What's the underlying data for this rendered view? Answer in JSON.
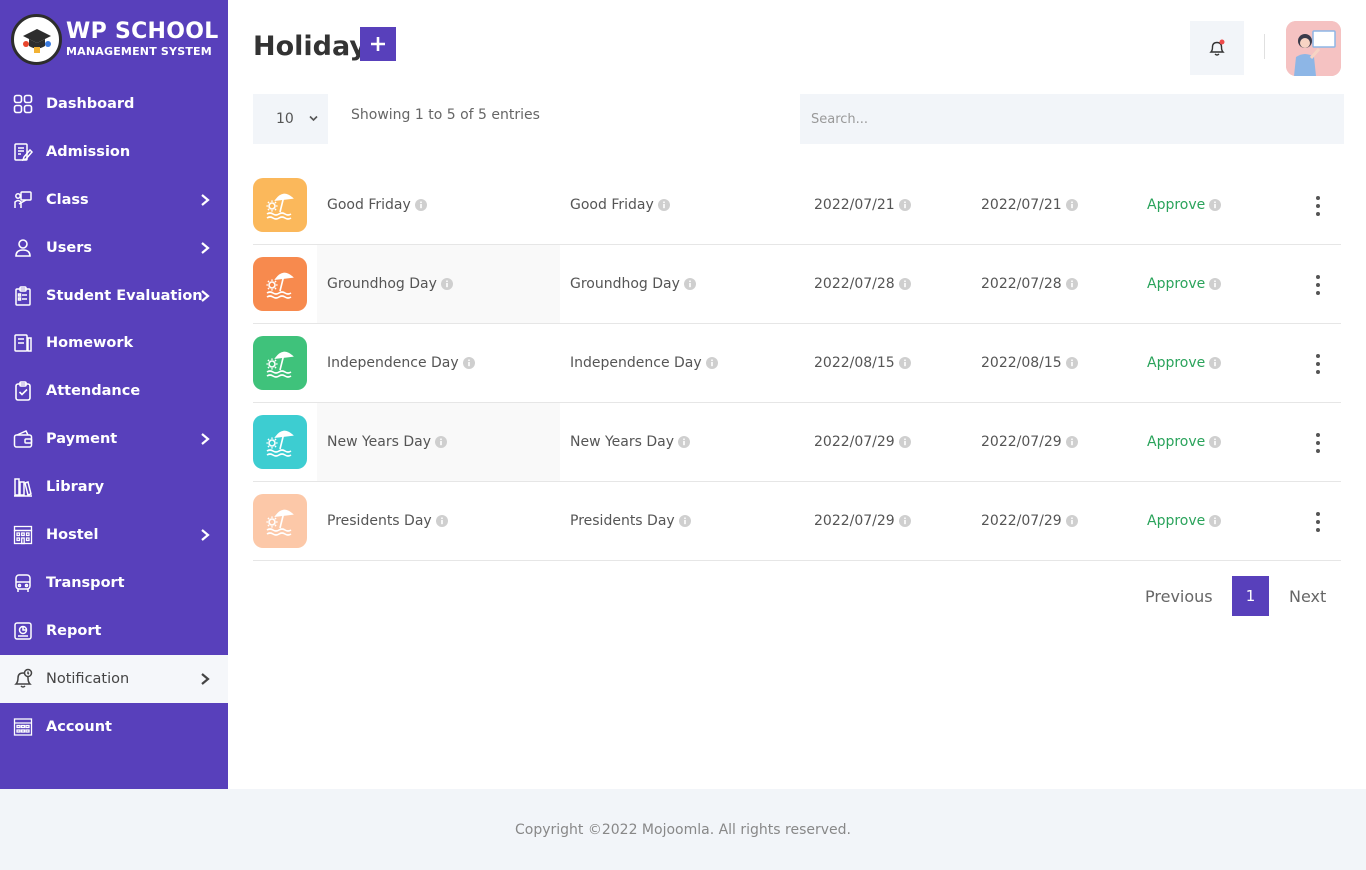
{
  "brand": {
    "title": "WP SCHOOL",
    "subtitle": "MANAGEMENT SYSTEM"
  },
  "sidebar": {
    "items": [
      {
        "label": "Dashboard",
        "icon": "grid-icon",
        "chevron": false
      },
      {
        "label": "Admission",
        "icon": "admission-icon",
        "chevron": false
      },
      {
        "label": "Class",
        "icon": "class-icon",
        "chevron": true
      },
      {
        "label": "Users",
        "icon": "user-icon",
        "chevron": true
      },
      {
        "label": "Student Evaluation",
        "icon": "clipboard-icon",
        "chevron": true
      },
      {
        "label": "Homework",
        "icon": "homework-icon",
        "chevron": false
      },
      {
        "label": "Attendance",
        "icon": "attendance-icon",
        "chevron": false
      },
      {
        "label": "Payment",
        "icon": "wallet-icon",
        "chevron": true
      },
      {
        "label": "Library",
        "icon": "library-icon",
        "chevron": false
      },
      {
        "label": "Hostel",
        "icon": "hostel-icon",
        "chevron": true
      },
      {
        "label": "Transport",
        "icon": "bus-icon",
        "chevron": false
      },
      {
        "label": "Report",
        "icon": "report-icon",
        "chevron": false
      },
      {
        "label": "Notification",
        "icon": "bell-icon",
        "chevron": true,
        "active": true
      },
      {
        "label": "Account",
        "icon": "account-icon",
        "chevron": false
      }
    ]
  },
  "header": {
    "title": "Holiday",
    "add_label": "+"
  },
  "controls": {
    "page_length": "10",
    "entries_info": "Showing 1 to 5 of 5 entries",
    "search_placeholder": "Search..."
  },
  "table": {
    "rows": [
      {
        "title": "Good Friday",
        "description": "Good Friday",
        "start_date": "2022/07/21",
        "end_date": "2022/07/21",
        "status": "Approve",
        "color": "#fbb85b"
      },
      {
        "title": "Groundhog Day",
        "description": "Groundhog Day",
        "start_date": "2022/07/28",
        "end_date": "2022/07/28",
        "status": "Approve",
        "color": "#f78a4e"
      },
      {
        "title": "Independence Day",
        "description": "Independence Day",
        "start_date": "2022/08/15",
        "end_date": "2022/08/15",
        "status": "Approve",
        "color": "#3fc27b"
      },
      {
        "title": "New Years Day",
        "description": "New Years Day",
        "start_date": "2022/07/29",
        "end_date": "2022/07/29",
        "status": "Approve",
        "color": "#3dcdd1"
      },
      {
        "title": "Presidents Day",
        "description": "Presidents Day",
        "start_date": "2022/07/29",
        "end_date": "2022/07/29",
        "status": "Approve",
        "color": "#fcc8a8"
      }
    ]
  },
  "pagination": {
    "previous": "Previous",
    "current": "1",
    "next": "Next"
  },
  "footer": {
    "copyright": "Copyright ©2022 Mojoomla. All rights reserved."
  },
  "colors": {
    "primary": "#5840bb",
    "status_approve": "#2aa35b",
    "panel": "#f2f5f9"
  }
}
